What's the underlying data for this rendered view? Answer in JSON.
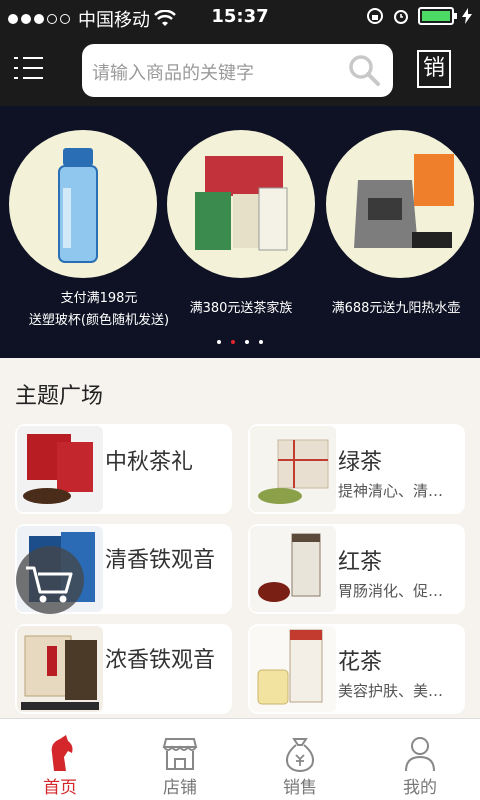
{
  "status_bar": {
    "carrier": "中国移动",
    "time": "15:37"
  },
  "nav": {
    "search_placeholder": "请输入商品的关键字",
    "sales_label": "销"
  },
  "banner": {
    "promos": [
      {
        "line1": "支付满198元",
        "line2": "送塑玻杯(颜色随机发送)"
      },
      {
        "line1": "满380元送茶家族",
        "line2": ""
      },
      {
        "line1": "满688元送九阳热水壶",
        "line2": ""
      }
    ]
  },
  "section": {
    "title": "主题广场"
  },
  "cards": [
    {
      "title": "中秋茶礼",
      "desc": ""
    },
    {
      "title": "绿茶",
      "desc": "提神清心、清…"
    },
    {
      "title": "清香铁观音",
      "desc": ""
    },
    {
      "title": "红茶",
      "desc": "胃肠消化、促…"
    },
    {
      "title": "浓香铁观音",
      "desc": ""
    },
    {
      "title": "花茶",
      "desc": "美容护肤、美…"
    }
  ],
  "tabs": [
    {
      "label": "首页"
    },
    {
      "label": "店铺"
    },
    {
      "label": "销售"
    },
    {
      "label": "我的"
    }
  ],
  "colors": {
    "accent": "#d3272b",
    "nav_bg": "#1c1b1c",
    "battery": "#4cd964"
  }
}
